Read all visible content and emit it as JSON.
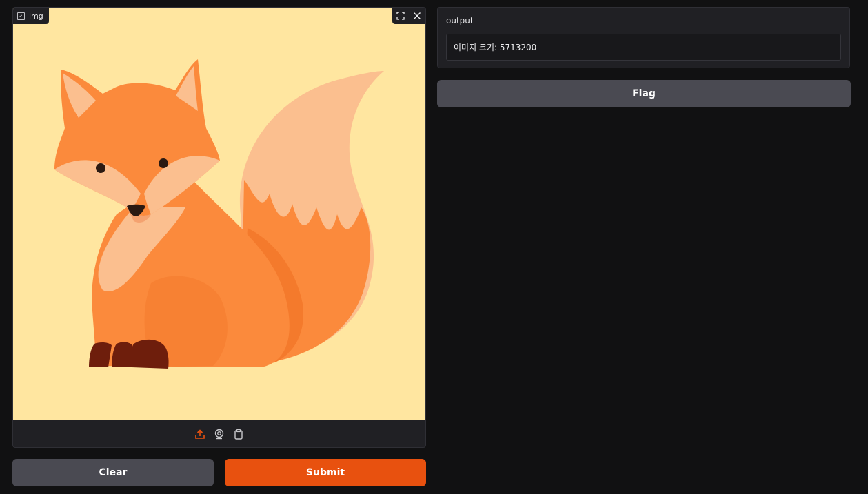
{
  "image_input": {
    "label": "img",
    "icon": "image-icon",
    "corner_tools": [
      {
        "name": "fullscreen-icon"
      },
      {
        "name": "close-icon"
      }
    ],
    "toolbar": [
      {
        "name": "upload-icon",
        "color": "#e8510f"
      },
      {
        "name": "webcam-icon",
        "color": "#c8c8cc"
      },
      {
        "name": "clipboard-icon",
        "color": "#c8c8cc"
      }
    ],
    "background_color": "#ffe6a0"
  },
  "buttons": {
    "clear": "Clear",
    "submit": "Submit",
    "flag": "Flag"
  },
  "output": {
    "label": "output",
    "value": "이미지 크기: 5713200"
  },
  "colors": {
    "accent": "#e8510f",
    "secondary_button": "#4a4a52",
    "background": "#111112",
    "panel": "#202024"
  }
}
